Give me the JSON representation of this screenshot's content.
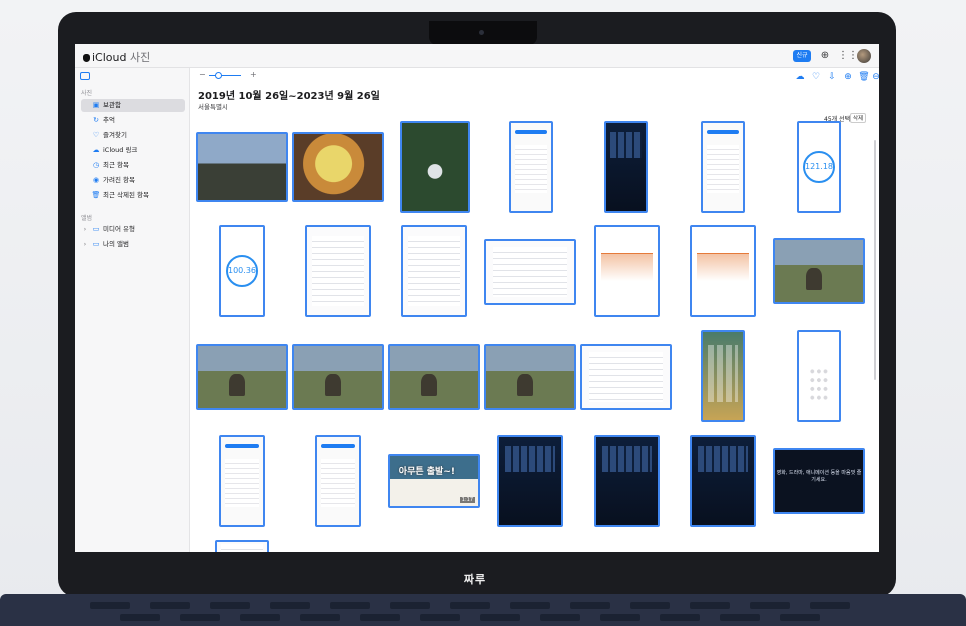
{
  "device_brand": "짜루",
  "app": {
    "name": "iCloud",
    "section": "사진",
    "upload_label": "신규"
  },
  "sidebar": {
    "section_photos": "사진",
    "items": [
      {
        "label": "보관함",
        "icon": "library-icon"
      },
      {
        "label": "추억",
        "icon": "memories-icon"
      },
      {
        "label": "즐겨찾기",
        "icon": "heart-icon"
      },
      {
        "label": "iCloud 링크",
        "icon": "cloud-link-icon"
      },
      {
        "label": "최근 항목",
        "icon": "clock-icon"
      },
      {
        "label": "가려진 항목",
        "icon": "eye-icon"
      },
      {
        "label": "최근 삭제된 항목",
        "icon": "trash-icon"
      }
    ],
    "section_albums": "앨범",
    "albums": [
      {
        "label": "미디어 유형",
        "icon": "folder-icon"
      },
      {
        "label": "나의 앨범",
        "icon": "folder-icon"
      }
    ]
  },
  "main": {
    "zoom_minus": "−",
    "zoom_plus": "+",
    "date_range": "2019년 10월 26일~2023년 9월 26일",
    "location": "서울특별시",
    "selected_count": "45개 선택됨",
    "tooltip": "삭제",
    "gauge_values": [
      "121.18",
      "100.36"
    ],
    "banner_text": "아무튼 출발~!",
    "banner_duration": "1:17",
    "wide_caption": "영화, 드라마, 애니메이션 등을 마음껏 즐기세요."
  }
}
